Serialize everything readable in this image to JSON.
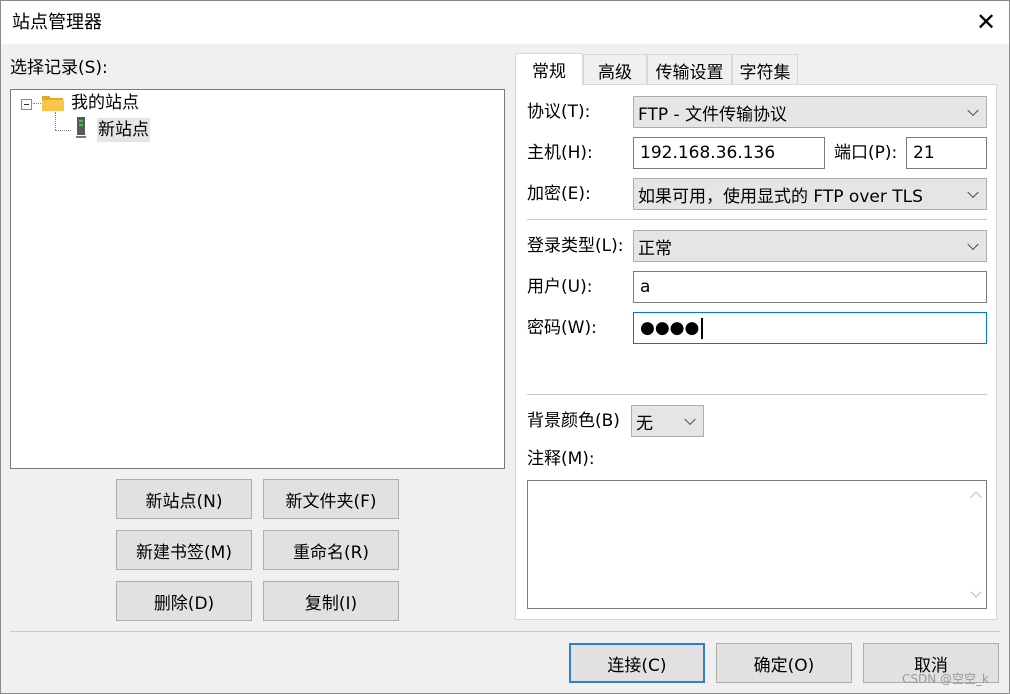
{
  "window": {
    "title": "站点管理器",
    "close_symbol": "✕"
  },
  "left": {
    "select_label": "选择记录(S):",
    "tree": {
      "root_label": "我的站点",
      "child_label": "新站点"
    },
    "buttons": {
      "new_site": "新站点(N)",
      "new_folder": "新文件夹(F)",
      "new_bookmark": "新建书签(M)",
      "rename": "重命名(R)",
      "delete": "删除(D)",
      "copy": "复制(I)"
    }
  },
  "tabs": [
    "常规",
    "高级",
    "传输设置",
    "字符集"
  ],
  "active_tab": "常规",
  "general": {
    "protocol_label": "协议(T):",
    "protocol_value": "FTP - 文件传输协议",
    "host_label": "主机(H):",
    "host_value": "192.168.36.136",
    "port_label": "端口(P):",
    "port_value": "21",
    "encryption_label": "加密(E):",
    "encryption_value": "如果可用，使用显式的 FTP over TLS",
    "logon_type_label": "登录类型(L):",
    "logon_type_value": "正常",
    "user_label": "用户(U):",
    "user_value": "a",
    "password_label": "密码(W):",
    "password_value": "●●●●",
    "background_color_label": "背景颜色(B)",
    "background_color_value": "无",
    "comments_label": "注释(M):",
    "comments_value": ""
  },
  "footer": {
    "connect": "连接(C)",
    "ok": "确定(O)",
    "cancel": "取消"
  },
  "watermark": "CSDN @空空_k",
  "colors": {
    "focus_border": "#0078d7",
    "primary_button_border": "#2f7fd1",
    "folder": "#f7c64a"
  }
}
